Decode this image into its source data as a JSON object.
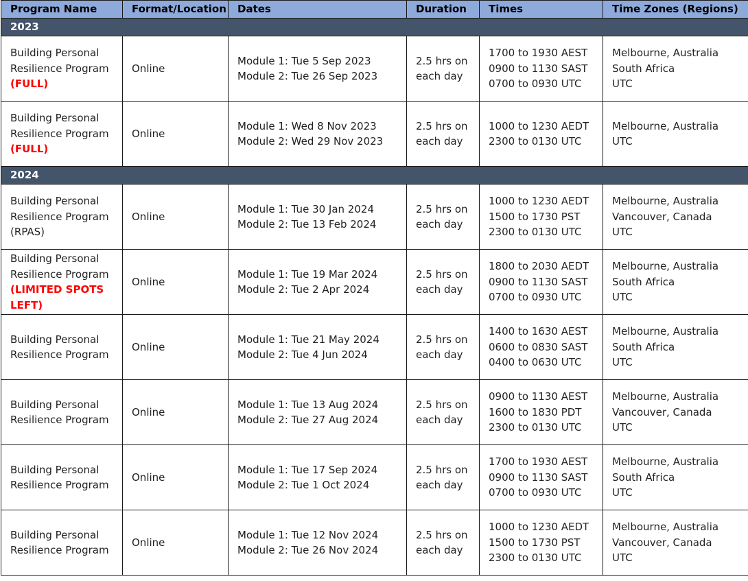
{
  "headers": [
    "Program Name",
    "Format/Location",
    "Dates",
    "Duration",
    "Times",
    "Time Zones (Regions)"
  ],
  "groups": [
    {
      "year": "2023",
      "rows": [
        {
          "name_lines": [
            "Building Personal",
            "Resilience Program"
          ],
          "status": "(FULL)",
          "format": "Online",
          "dates": [
            "Module 1: Tue 5 Sep 2023",
            "Module 2: Tue 26 Sep 2023"
          ],
          "duration": [
            "2.5 hrs on",
            "each day"
          ],
          "times": [
            "1700 to 1930 AEST",
            "0900 to 1130 SAST",
            "0700 to 0930 UTC"
          ],
          "zones": [
            "Melbourne, Australia",
            "South Africa",
            "UTC"
          ]
        },
        {
          "name_lines": [
            "Building Personal",
            "Resilience Program"
          ],
          "status": "(FULL)",
          "format": "Online",
          "dates": [
            "Module 1: Wed 8 Nov 2023",
            "Module 2: Wed 29 Nov 2023"
          ],
          "duration": [
            "2.5 hrs on",
            "each day"
          ],
          "times": [
            "1000 to 1230 AEDT",
            "2300 to 0130 UTC"
          ],
          "zones": [
            "Melbourne, Australia",
            "UTC"
          ]
        }
      ]
    },
    {
      "year": "2024",
      "rows": [
        {
          "name_lines": [
            "Building Personal",
            "Resilience Program",
            "(RPAS)"
          ],
          "status": "",
          "format": "Online",
          "dates": [
            "Module 1: Tue 30 Jan 2024",
            "Module 2: Tue 13 Feb 2024"
          ],
          "duration": [
            "2.5 hrs on",
            "each day"
          ],
          "times": [
            "1000 to 1230 AEDT",
            "1500 to 1730 PST",
            "2300 to 0130 UTC"
          ],
          "zones": [
            "Melbourne, Australia",
            "Vancouver, Canada",
            "UTC"
          ]
        },
        {
          "name_lines": [
            "Building Personal",
            "Resilience Program"
          ],
          "status": "(LIMITED SPOTS LEFT)",
          "format": "Online",
          "dates": [
            "Module 1: Tue 19 Mar 2024",
            "Module 2: Tue 2 Apr 2024"
          ],
          "duration": [
            "2.5 hrs on",
            "each day"
          ],
          "times": [
            "1800 to 2030 AEDT",
            "0900 to 1130 SAST",
            "0700 to 0930 UTC"
          ],
          "zones": [
            "Melbourne, Australia",
            "South Africa",
            "UTC"
          ]
        },
        {
          "name_lines": [
            "Building Personal",
            "Resilience Program"
          ],
          "status": "",
          "format": "Online",
          "dates": [
            "Module 1: Tue 21 May 2024",
            "Module 2: Tue 4 Jun 2024"
          ],
          "duration": [
            "2.5 hrs on",
            "each day"
          ],
          "times": [
            "1400 to 1630 AEST",
            "0600 to 0830 SAST",
            "0400 to 0630 UTC"
          ],
          "zones": [
            "Melbourne, Australia",
            "South Africa",
            "UTC"
          ]
        },
        {
          "name_lines": [
            "Building Personal",
            "Resilience Program"
          ],
          "status": "",
          "format": "Online",
          "dates": [
            "Module 1: Tue 13 Aug 2024",
            "Module 2: Tue 27 Aug 2024"
          ],
          "duration": [
            "2.5 hrs on",
            "each day"
          ],
          "times": [
            "0900 to 1130 AEST",
            "1600 to 1830 PDT",
            "2300 to 0130 UTC"
          ],
          "zones": [
            "Melbourne, Australia",
            "Vancouver, Canada",
            "UTC"
          ]
        },
        {
          "name_lines": [
            "Building Personal",
            "Resilience Program"
          ],
          "status": "",
          "format": "Online",
          "dates": [
            "Module 1: Tue 17 Sep 2024",
            "Module 2: Tue 1 Oct 2024"
          ],
          "duration": [
            "2.5 hrs on",
            "each day"
          ],
          "times": [
            "1700 to 1930 AEST",
            "0900 to 1130 SAST",
            "0700 to 0930 UTC"
          ],
          "zones": [
            "Melbourne, Australia",
            "South Africa",
            "UTC"
          ]
        },
        {
          "name_lines": [
            "Building Personal",
            "Resilience Program"
          ],
          "status": "",
          "format": "Online",
          "dates": [
            "Module 1: Tue 12 Nov 2024",
            "Module 2: Tue 26 Nov 2024"
          ],
          "duration": [
            "2.5 hrs on",
            "each day"
          ],
          "times": [
            "1000 to 1230 AEDT",
            "1500 to 1730 PST",
            "2300 to 0130 UTC"
          ],
          "zones": [
            "Melbourne, Australia",
            "Vancouver, Canada",
            "UTC"
          ]
        }
      ]
    }
  ],
  "colors": {
    "header_bg": "#8eaadb",
    "year_bg": "#44546a",
    "status_red": "#ff0000"
  }
}
